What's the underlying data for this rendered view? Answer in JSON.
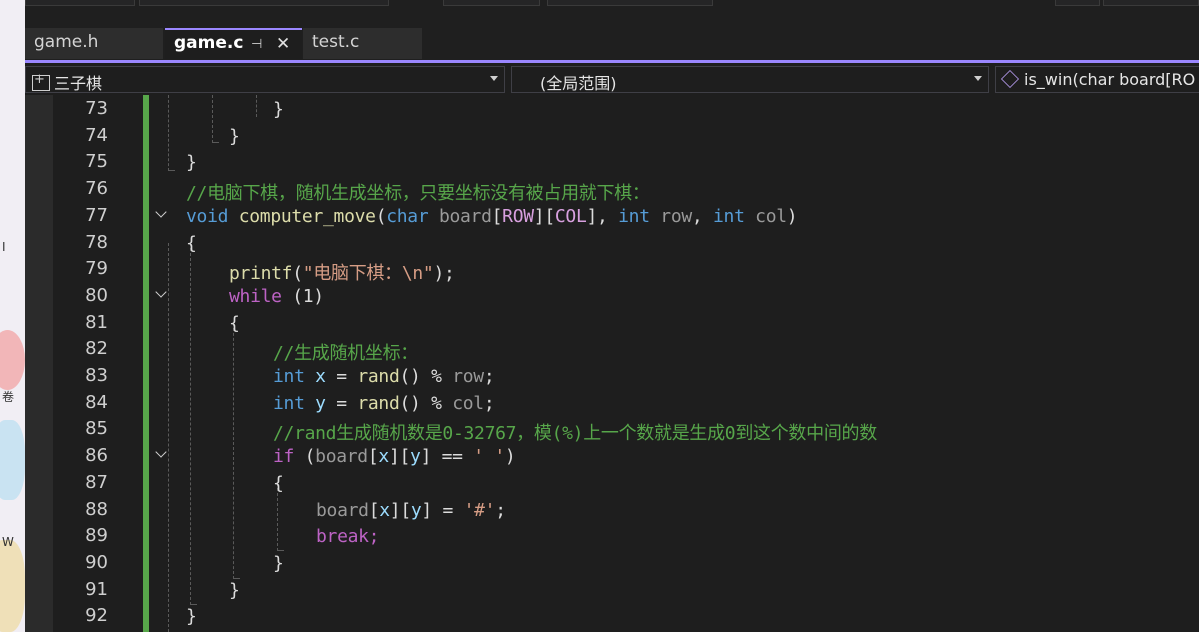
{
  "tabs": [
    {
      "label": "game.h",
      "active": false
    },
    {
      "label": "game.c",
      "active": true
    },
    {
      "label": "test.c",
      "active": false
    }
  ],
  "nav": {
    "project": "三子棋",
    "scope": "(全局范围)",
    "member": "is_win(char board[RO"
  },
  "accent_color": "#9b87ff",
  "code_lines": [
    {
      "n": "73",
      "t": "}"
    },
    {
      "n": "74",
      "t": "}"
    },
    {
      "n": "75",
      "t": "}"
    },
    {
      "n": "76",
      "t": "//电脑下棋，随机生成坐标，只要坐标没有被占用就下棋："
    },
    {
      "n": "77",
      "t": "void computer_move(char board[ROW][COL], int row, int col)"
    },
    {
      "n": "78",
      "t": "{"
    },
    {
      "n": "79",
      "t": "printf(\"电脑下棋：\\n\");"
    },
    {
      "n": "80",
      "t": "while (1)"
    },
    {
      "n": "81",
      "t": "{"
    },
    {
      "n": "82",
      "t": "//生成随机坐标："
    },
    {
      "n": "83",
      "t": "int x = rand() % row;"
    },
    {
      "n": "84",
      "t": "int y = rand() % col;"
    },
    {
      "n": "85",
      "t": "//rand生成随机数是0-32767，模(%)上一个数就是生成0到这个数中间的数"
    },
    {
      "n": "86",
      "t": "if (board[x][y] == ' ')"
    },
    {
      "n": "87",
      "t": "{"
    },
    {
      "n": "88",
      "t": "board[x][y] = '#';"
    },
    {
      "n": "89",
      "t": "break;"
    },
    {
      "n": "90",
      "t": "}"
    },
    {
      "n": "91",
      "t": "}"
    },
    {
      "n": "92",
      "t": "}"
    }
  ],
  "desktop_glyphs": [
    "I",
    "卷",
    "W"
  ]
}
